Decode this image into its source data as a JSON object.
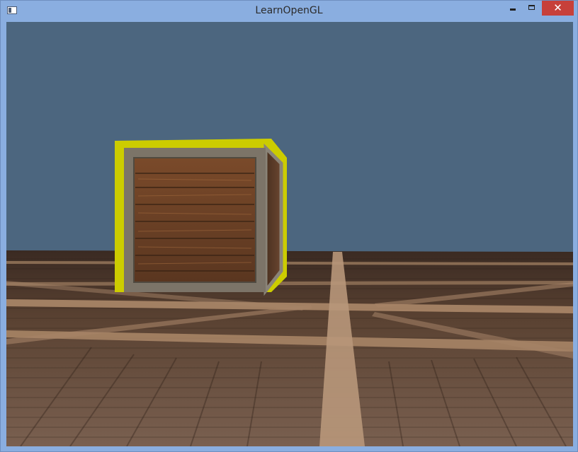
{
  "window": {
    "title": "LearnOpenGL",
    "close_glyph": "✕"
  },
  "icons": {
    "app": "app-window-icon",
    "minimize": "minimize-icon",
    "maximize": "maximize-icon",
    "close": "close-icon"
  },
  "colors": {
    "clear_color": "#4c667f",
    "outline": "#cccc00",
    "titlebar": "#8aaee0",
    "close_button": "#c7403a"
  },
  "scene": {
    "objects": [
      "floor-plane",
      "wooden-container"
    ],
    "effect": "stencil-outline"
  }
}
